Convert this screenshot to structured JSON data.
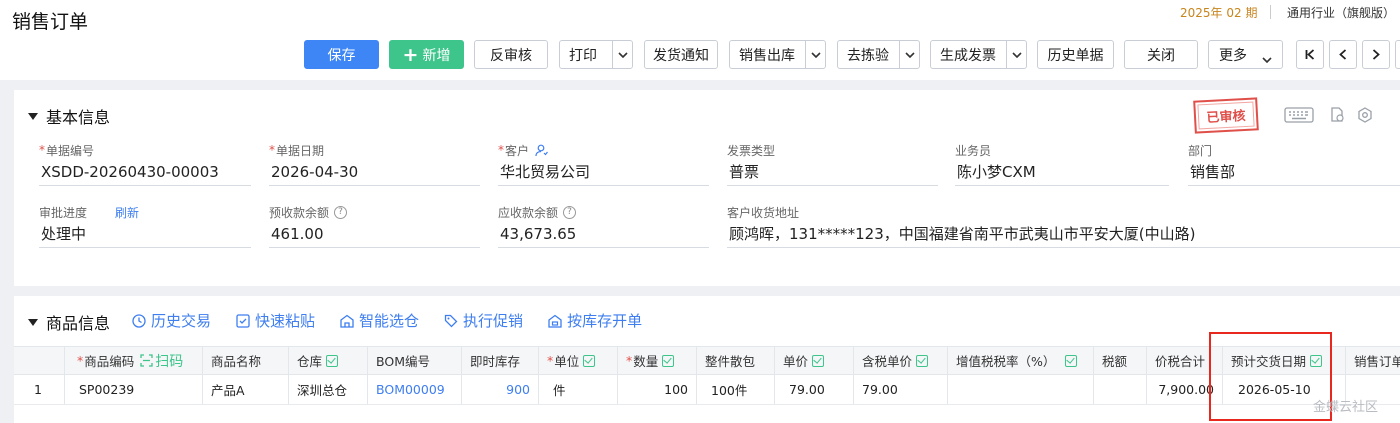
{
  "header": {
    "title": "销售订单",
    "period": "2025年 02 期",
    "industry": "通用行业（旗舰版）"
  },
  "toolbar": {
    "save": "保存",
    "add": "新增",
    "unaudit": "反审核",
    "print": "打印",
    "ship_notice": "发货通知",
    "sales_out": "销售出库",
    "pick_check": "去拣验",
    "gen_invoice": "生成发票",
    "history": "历史单据",
    "close": "关闭",
    "more": "更多"
  },
  "basic": {
    "section_title": "基本信息",
    "stamp": "已审核",
    "fields": {
      "doc_no": {
        "label": "单据编号",
        "value": "XSDD-20260430-00003"
      },
      "doc_date": {
        "label": "单据日期",
        "value": "2026-04-30"
      },
      "customer": {
        "label": "客户",
        "value": "华北贸易公司"
      },
      "invoice_type": {
        "label": "发票类型",
        "value": "普票"
      },
      "salesman": {
        "label": "业务员",
        "value": "陈小梦CXM"
      },
      "dept": {
        "label": "部门",
        "value": "销售部"
      },
      "approval": {
        "label": "审批进度",
        "value": "处理中",
        "refresh": "刷新"
      },
      "prepaid": {
        "label": "预收款余额",
        "value": "461.00"
      },
      "receivable": {
        "label": "应收款余额",
        "value": "43,673.65"
      },
      "address": {
        "label": "客户收货地址",
        "value": "顾鸿晖，131*****123，中国福建省南平市武夷山市平安大厦(中山路)"
      }
    }
  },
  "goods": {
    "section_title": "商品信息",
    "tools": [
      "历史交易",
      "快速粘贴",
      "智能选仓",
      "执行促销",
      "按库存开单"
    ],
    "scan": "扫码",
    "columns": {
      "code": "商品编码",
      "name": "商品名称",
      "warehouse": "仓库",
      "bom": "BOM编号",
      "stock": "即时库存",
      "unit": "单位",
      "qty": "数量",
      "pack": "整件散包",
      "price": "单价",
      "tax_price": "含税单价",
      "vat_rate": "增值税税率（%）",
      "tax": "税额",
      "total": "价税合计",
      "delivery": "预计交货日期",
      "order_no": "销售订单"
    },
    "rows": [
      {
        "idx": "1",
        "code": "SP00239",
        "name": "产品A",
        "warehouse": "深圳总仓",
        "bom": "BOM00009",
        "stock": "900",
        "unit": "件",
        "qty": "100",
        "pack": "100件",
        "price": "79.00",
        "tax_price": "79.00",
        "vat_rate": "",
        "tax": "",
        "total": "7,900.00",
        "delivery": "2026-05-10",
        "order_no": ""
      }
    ]
  },
  "watermark": "金蝶云社区"
}
